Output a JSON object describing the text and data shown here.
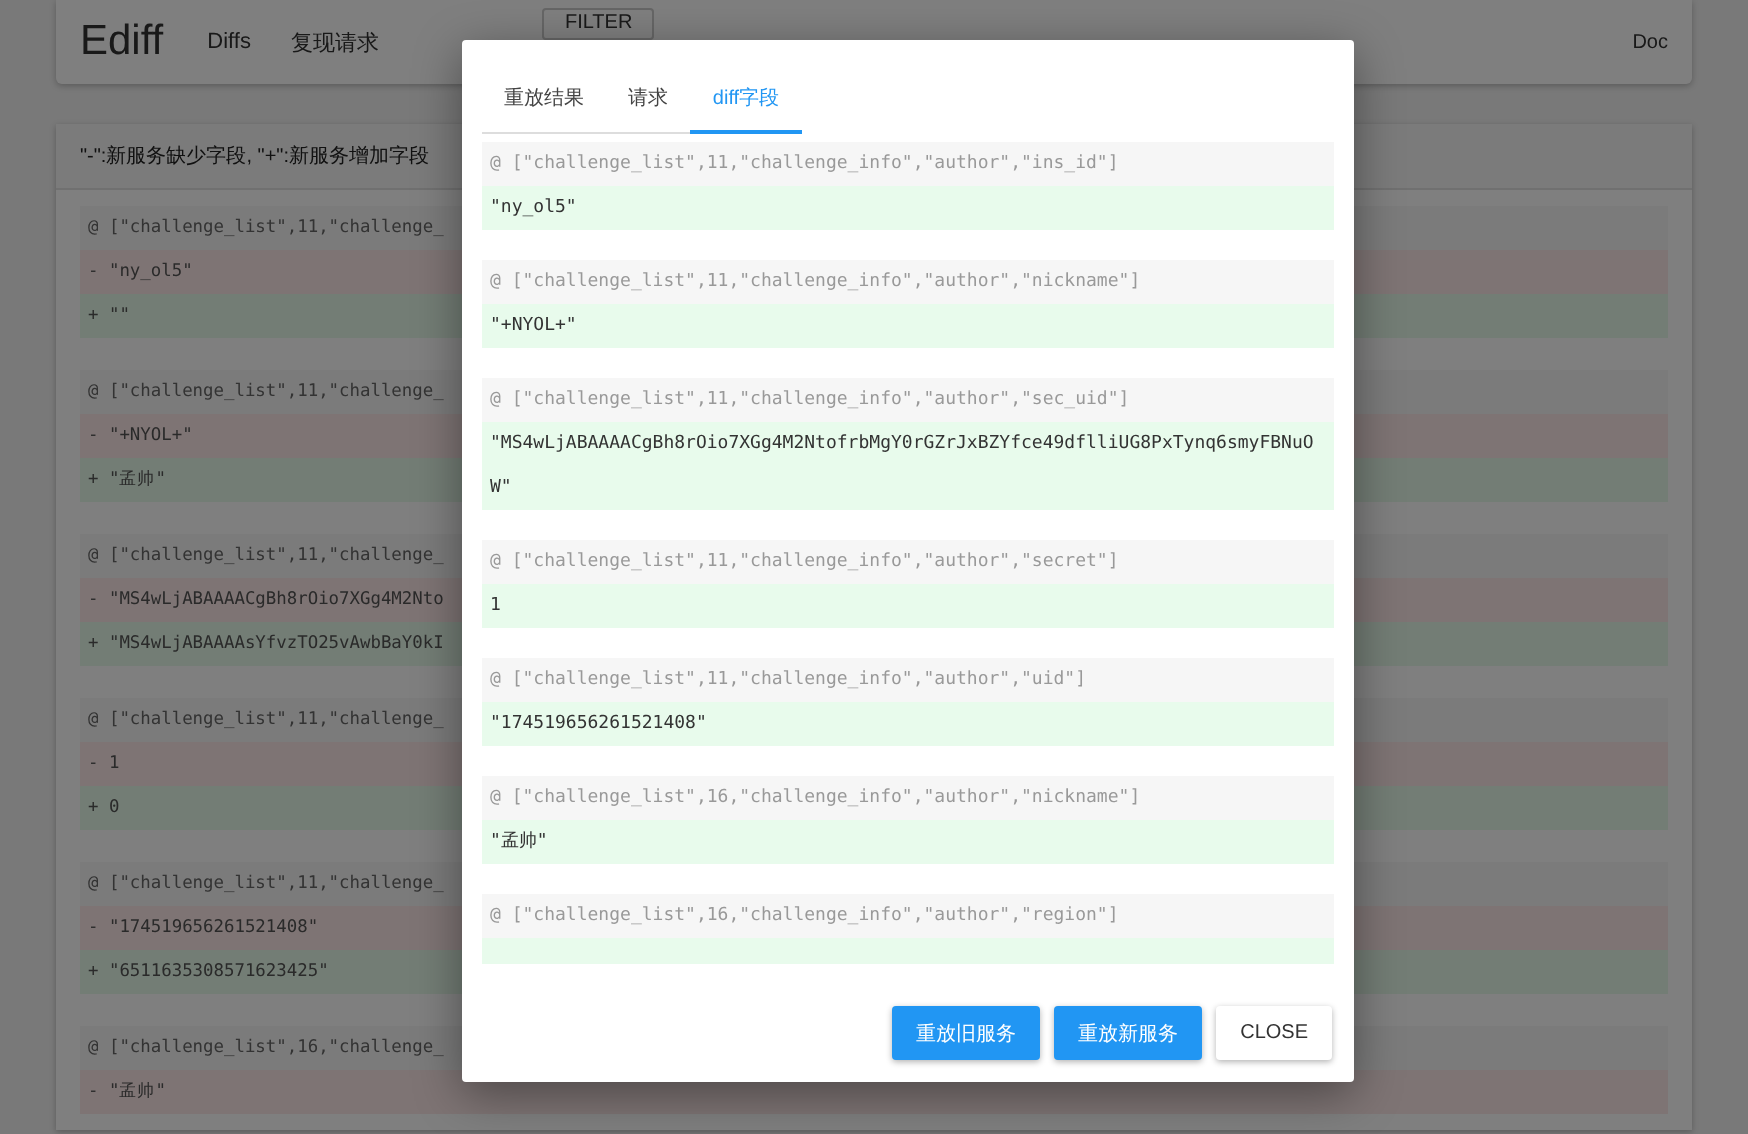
{
  "app_bar": {
    "title": "Ediff",
    "nav": [
      {
        "label": "Diffs"
      },
      {
        "label": "复现请求"
      }
    ],
    "filter_button": "FILTER",
    "doc_link": "Doc"
  },
  "legend": "\"-\":新服务缺少字段, \"+\":新服务增加字段",
  "diffs": [
    {
      "path": "@ [\"challenge_list\",11,\"challenge_",
      "removed": "- \"ny_ol5\"",
      "added": "+ \"\""
    },
    {
      "path": "@ [\"challenge_list\",11,\"challenge_",
      "removed": "- \"+NYOL+\"",
      "added": "+ \"孟帅\""
    },
    {
      "path": "@ [\"challenge_list\",11,\"challenge_",
      "removed": "- \"MS4wLjABAAAACgBh8rOio7XGg4M2Nto",
      "added": "+ \"MS4wLjABAAAAsYfvzTO25vAwbBaY0kI"
    },
    {
      "path": "@ [\"challenge_list\",11,\"challenge_",
      "removed": "- 1",
      "added": "+ 0"
    },
    {
      "path": "@ [\"challenge_list\",11,\"challenge_",
      "removed": "- \"174519656261521408\"",
      "added": "+ \"6511635308571623425\""
    },
    {
      "path": "@ [\"challenge_list\",16,\"challenge_",
      "removed": "- \"孟帅\""
    }
  ],
  "dialog": {
    "tabs": [
      {
        "label": "重放结果",
        "selected": false
      },
      {
        "label": "请求",
        "selected": false
      },
      {
        "label": "diff字段",
        "selected": true
      }
    ],
    "fields": [
      {
        "path": "@ [\"challenge_list\",11,\"challenge_info\",\"author\",\"ins_id\"]",
        "value": "\"ny_ol5\""
      },
      {
        "path": "@ [\"challenge_list\",11,\"challenge_info\",\"author\",\"nickname\"]",
        "value": "\"+NYOL+\""
      },
      {
        "path": "@ [\"challenge_list\",11,\"challenge_info\",\"author\",\"sec_uid\"]",
        "value": "\"MS4wLjABAAAACgBh8rOio7XGg4M2NtofrbMgY0rGZrJxBZYfce49dflliUG8PxTynq6smyFBNuOW\""
      },
      {
        "path": "@ [\"challenge_list\",11,\"challenge_info\",\"author\",\"secret\"]",
        "value": "1"
      },
      {
        "path": "@ [\"challenge_list\",11,\"challenge_info\",\"author\",\"uid\"]",
        "value": "\"174519656261521408\""
      },
      {
        "path": "@ [\"challenge_list\",16,\"challenge_info\",\"author\",\"nickname\"]",
        "value": "\"孟帅\""
      },
      {
        "path": "@ [\"challenge_list\",16,\"challenge_info\",\"author\",\"region\"]"
      }
    ],
    "buttons": [
      {
        "label": "重放旧服务",
        "kind": "primary"
      },
      {
        "label": "重放新服务",
        "kind": "primary"
      },
      {
        "label": "CLOSE",
        "kind": "plain"
      }
    ]
  }
}
